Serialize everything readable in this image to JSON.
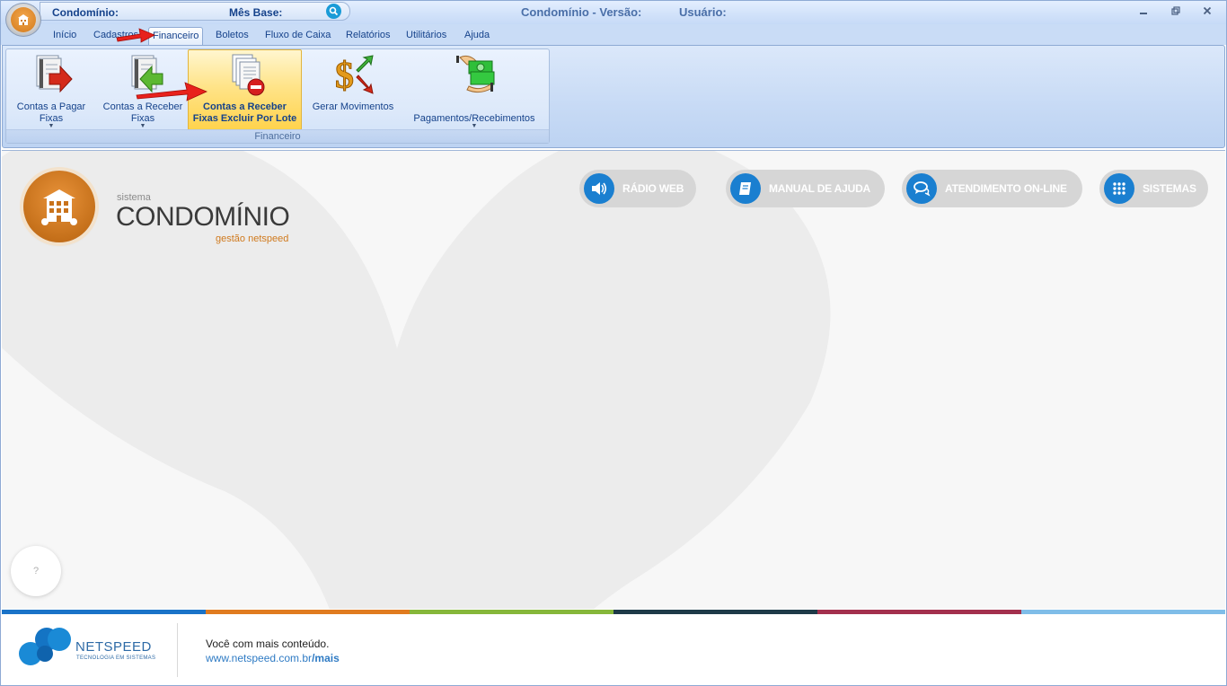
{
  "titlebar": {
    "condominio_label": "Condomínio:",
    "mes_base_label": "Mês Base:",
    "title": "Condomínio - Versão:",
    "usuario_label": "Usuário:"
  },
  "tabs": [
    {
      "label": "Início"
    },
    {
      "label": "Cadastros"
    },
    {
      "label": "Financeiro",
      "active": true
    },
    {
      "label": "Boletos"
    },
    {
      "label": "Fluxo de Caixa"
    },
    {
      "label": "Relatórios"
    },
    {
      "label": "Utilitários"
    },
    {
      "label": "Ajuda"
    }
  ],
  "ribbon": {
    "group_label": "Financeiro",
    "buttons": [
      {
        "line1": "Contas a Pagar",
        "line2": "Fixas",
        "icon": "contas-pagar-icon"
      },
      {
        "line1": "Contas a Receber",
        "line2": "Fixas",
        "icon": "contas-receber-icon"
      },
      {
        "line1": "Contas a Receber",
        "line2": "Fixas Excluir Por Lote",
        "icon": "excluir-lote-icon",
        "highlighted": true
      },
      {
        "line1": "Gerar Movimentos",
        "icon": "dollar-icon"
      },
      {
        "line1": "Pagamentos/Recebimentos",
        "icon": "payment-icon"
      }
    ]
  },
  "content": {
    "logo_small": "sistema",
    "logo_big": "CONDOMÍNIO",
    "logo_sub": "gestão netspeed",
    "pills": [
      {
        "label": "RÁDIO WEB",
        "icon": "speaker-icon"
      },
      {
        "label": "MANUAL DE AJUDA",
        "icon": "book-icon"
      },
      {
        "label": "ATENDIMENTO ON-LINE",
        "icon": "chat-icon"
      },
      {
        "label": "SISTEMAS",
        "icon": "grid-icon"
      }
    ],
    "help": "?"
  },
  "footer": {
    "brand": "NETSPEED",
    "tagline": "TECNOLOGIA EM SISTEMAS",
    "line1": "Você com mais conteúdo.",
    "url_main": "www.netspeed.com.br",
    "url_path": "/mais",
    "colors": [
      "#1a73c8",
      "#e07b1f",
      "#86b73a",
      "#1e3a48",
      "#a3304d",
      "#7fbde8"
    ]
  },
  "colors": {
    "accent_blue": "#15428b",
    "orange": "#d07a1e",
    "pill_blue": "#1a7fd0"
  }
}
